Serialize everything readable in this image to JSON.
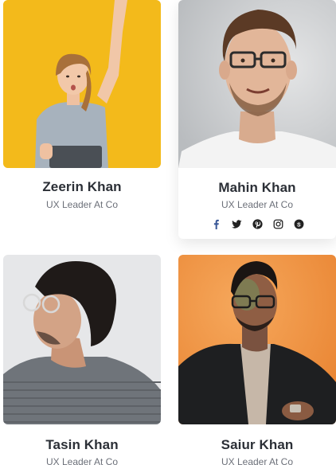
{
  "team": [
    {
      "name": "Zeerin Khan",
      "role": "UX Leader At Co",
      "photo_bg": "#f2b613"
    },
    {
      "name": "Mahin Khan",
      "role": "UX Leader At Co",
      "photo_bg": "#cfd1d2",
      "social": [
        "facebook-icon",
        "twitter-icon",
        "pinterest-icon",
        "instagram-icon",
        "skype-icon"
      ]
    },
    {
      "name": "Tasin Khan",
      "role": "UX Leader At Co",
      "photo_bg": "#e4e6e8"
    },
    {
      "name": "Saiur Khan",
      "role": "UX Leader At Co",
      "photo_bg": "#f29a4c"
    }
  ],
  "colors": {
    "name": "#2b2f36",
    "role": "#6c7079",
    "facebook": "#3b5998",
    "icon": "#222222"
  }
}
